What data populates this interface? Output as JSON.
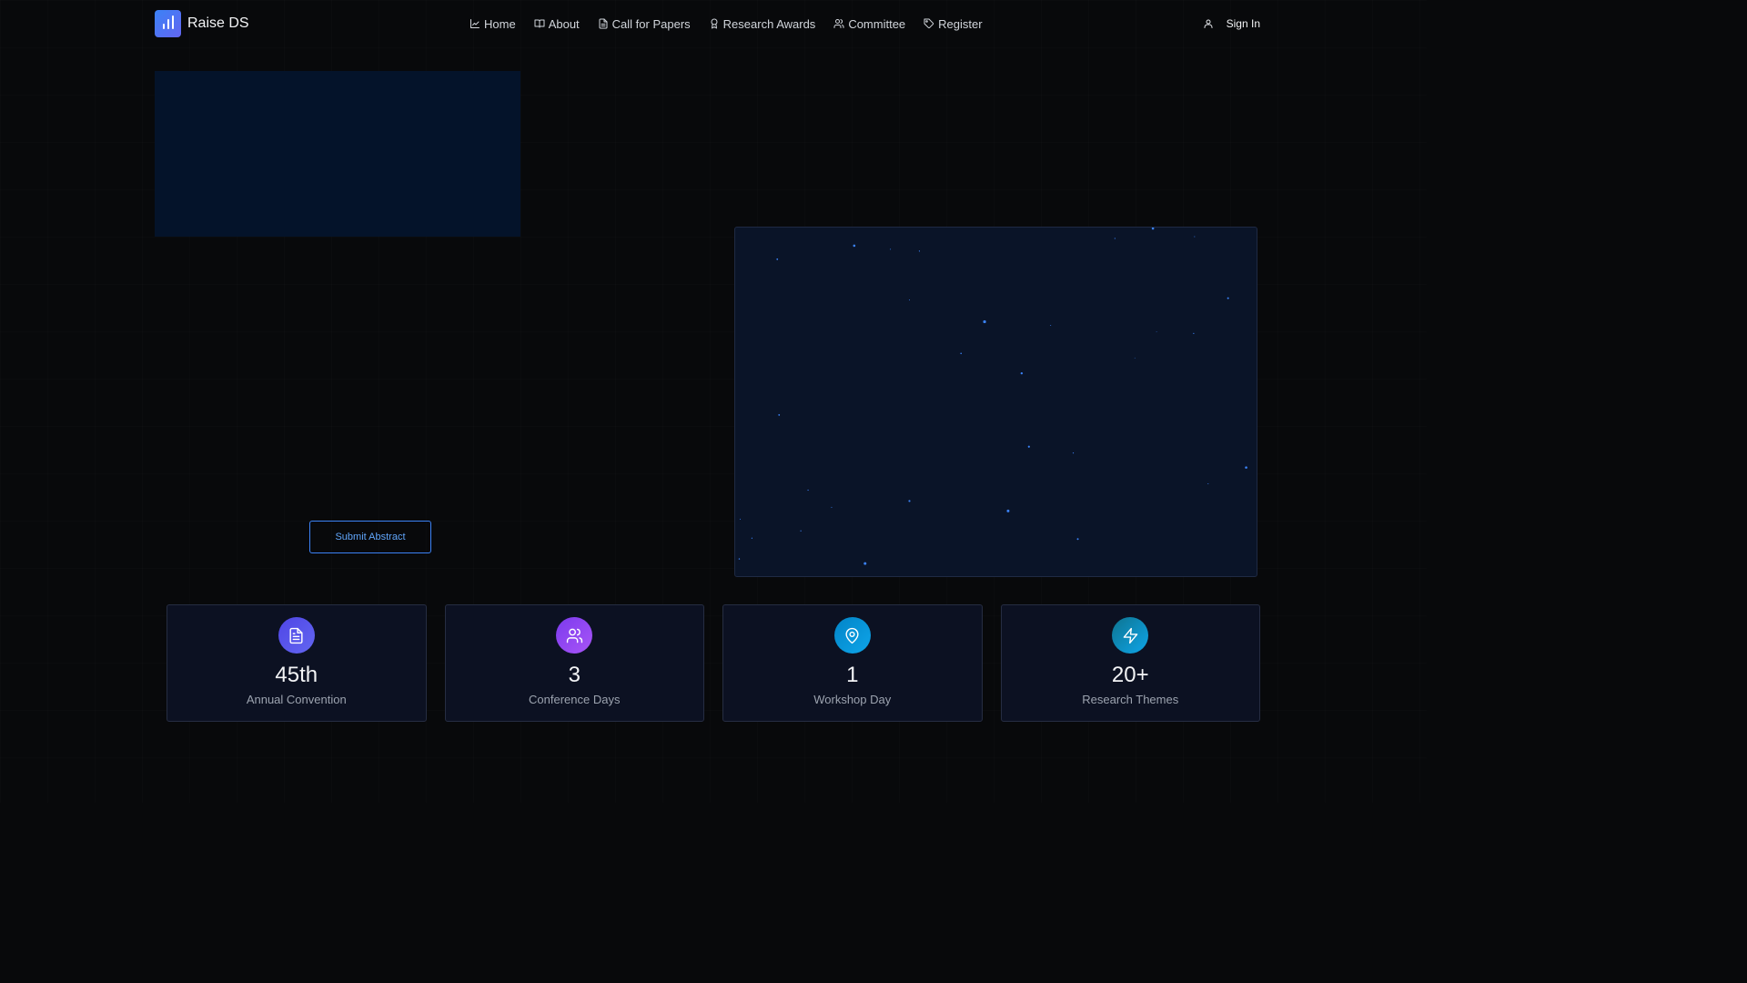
{
  "brand": {
    "name": "Raise DS",
    "logo_icon": "bar-chart-icon"
  },
  "nav": {
    "links": [
      {
        "label": "Home",
        "icon": "line-chart-icon"
      },
      {
        "label": "About",
        "icon": "book-open-icon"
      },
      {
        "label": "Call for Papers",
        "icon": "document-icon"
      },
      {
        "label": "Research Awards",
        "icon": "award-icon"
      },
      {
        "label": "Committee",
        "icon": "users-icon"
      },
      {
        "label": "Register",
        "icon": "tag-icon"
      }
    ],
    "signin_label": "Sign In",
    "signin_icon": "user-icon"
  },
  "hero": {
    "cta_label": "Submit Abstract",
    "accent_color": "#3b82f6"
  },
  "stats": [
    {
      "value": "45th",
      "label": "Annual Convention",
      "icon": "document-icon",
      "color": "#4f46e5"
    },
    {
      "value": "3",
      "label": "Conference Days",
      "icon": "users-icon",
      "color": "#8b5cf6"
    },
    {
      "value": "1",
      "label": "Workshop Day",
      "icon": "map-pin-icon",
      "color": "#0ea5e9"
    },
    {
      "value": "20+",
      "label": "Research Themes",
      "icon": "zap-icon",
      "color": "#0891b2"
    }
  ]
}
